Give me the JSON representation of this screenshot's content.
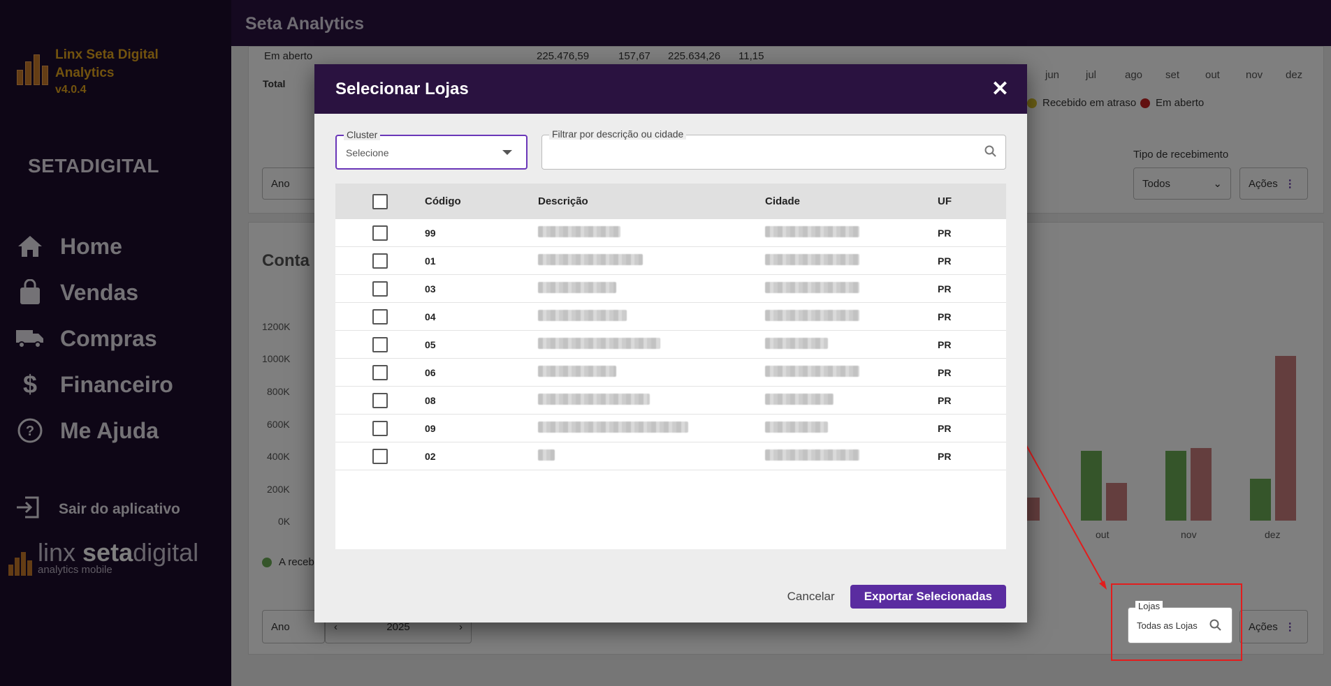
{
  "app": {
    "title": "Seta Analytics",
    "brand_line1": "Linx Seta Digital",
    "brand_line2": "Analytics",
    "version": "v4.0.4",
    "company": "SETADIGITAL"
  },
  "sidebar": {
    "items": [
      {
        "label": "Home",
        "icon": "home-icon"
      },
      {
        "label": "Vendas",
        "icon": "bag-icon"
      },
      {
        "label": "Compras",
        "icon": "truck-icon"
      },
      {
        "label": "Financeiro",
        "icon": "dollar-icon"
      },
      {
        "label": "Me Ajuda",
        "icon": "help-icon"
      }
    ],
    "exit_label": "Sair do aplicativo",
    "footer_light": "linx ",
    "footer_bold": "seta",
    "footer_rest": "digital",
    "footer_sub": "analytics mobile"
  },
  "background": {
    "row_label": "Em aberto",
    "row_v1": "225.476,59",
    "row_v2": "157,67",
    "row_v3": "225.634,26",
    "row_v4": "11,15",
    "total_label": "Total",
    "months": [
      "jun",
      "jul",
      "ago",
      "set",
      "out",
      "nov",
      "dez"
    ],
    "legend_late": "Recebido em atraso",
    "legend_open": "Em aberto",
    "tipo_label": "Tipo de recebimento",
    "tipo_value": "Todos",
    "acoes": "Ações",
    "ano": "Ano",
    "card2_title": "Conta",
    "y_ticks": [
      "1200K",
      "1000K",
      "800K",
      "600K",
      "400K",
      "200K",
      "0K"
    ],
    "x_ticks": [
      "out",
      "nov",
      "dez"
    ],
    "legend_received": "A receb",
    "year": "2025"
  },
  "modal": {
    "title": "Selecionar Lojas",
    "cluster_label": "Cluster",
    "cluster_value": "Selecione",
    "filter_label": "Filtrar por descrição ou cidade",
    "filter_value": "",
    "columns": {
      "codigo": "Código",
      "descricao": "Descrição",
      "cidade": "Cidade",
      "uf": "UF"
    },
    "rows": [
      {
        "codigo": "99",
        "uf": "PR"
      },
      {
        "codigo": "01",
        "uf": "PR"
      },
      {
        "codigo": "03",
        "uf": "PR"
      },
      {
        "codigo": "04",
        "uf": "PR"
      },
      {
        "codigo": "05",
        "uf": "PR"
      },
      {
        "codigo": "06",
        "uf": "PR"
      },
      {
        "codigo": "08",
        "uf": "PR"
      },
      {
        "codigo": "09",
        "uf": "PR"
      },
      {
        "codigo": "02",
        "uf": "PR"
      }
    ],
    "cancel_label": "Cancelar",
    "export_label": "Exportar Selecionadas"
  },
  "lojas_field": {
    "label": "Lojas",
    "value": "Todas as Lojas"
  },
  "colors": {
    "primary": "#5a2ca0",
    "header": "#2a1240",
    "sidebar": "#1d0c2d",
    "brand": "#e5a61d",
    "highlight": "#e21d1d"
  }
}
